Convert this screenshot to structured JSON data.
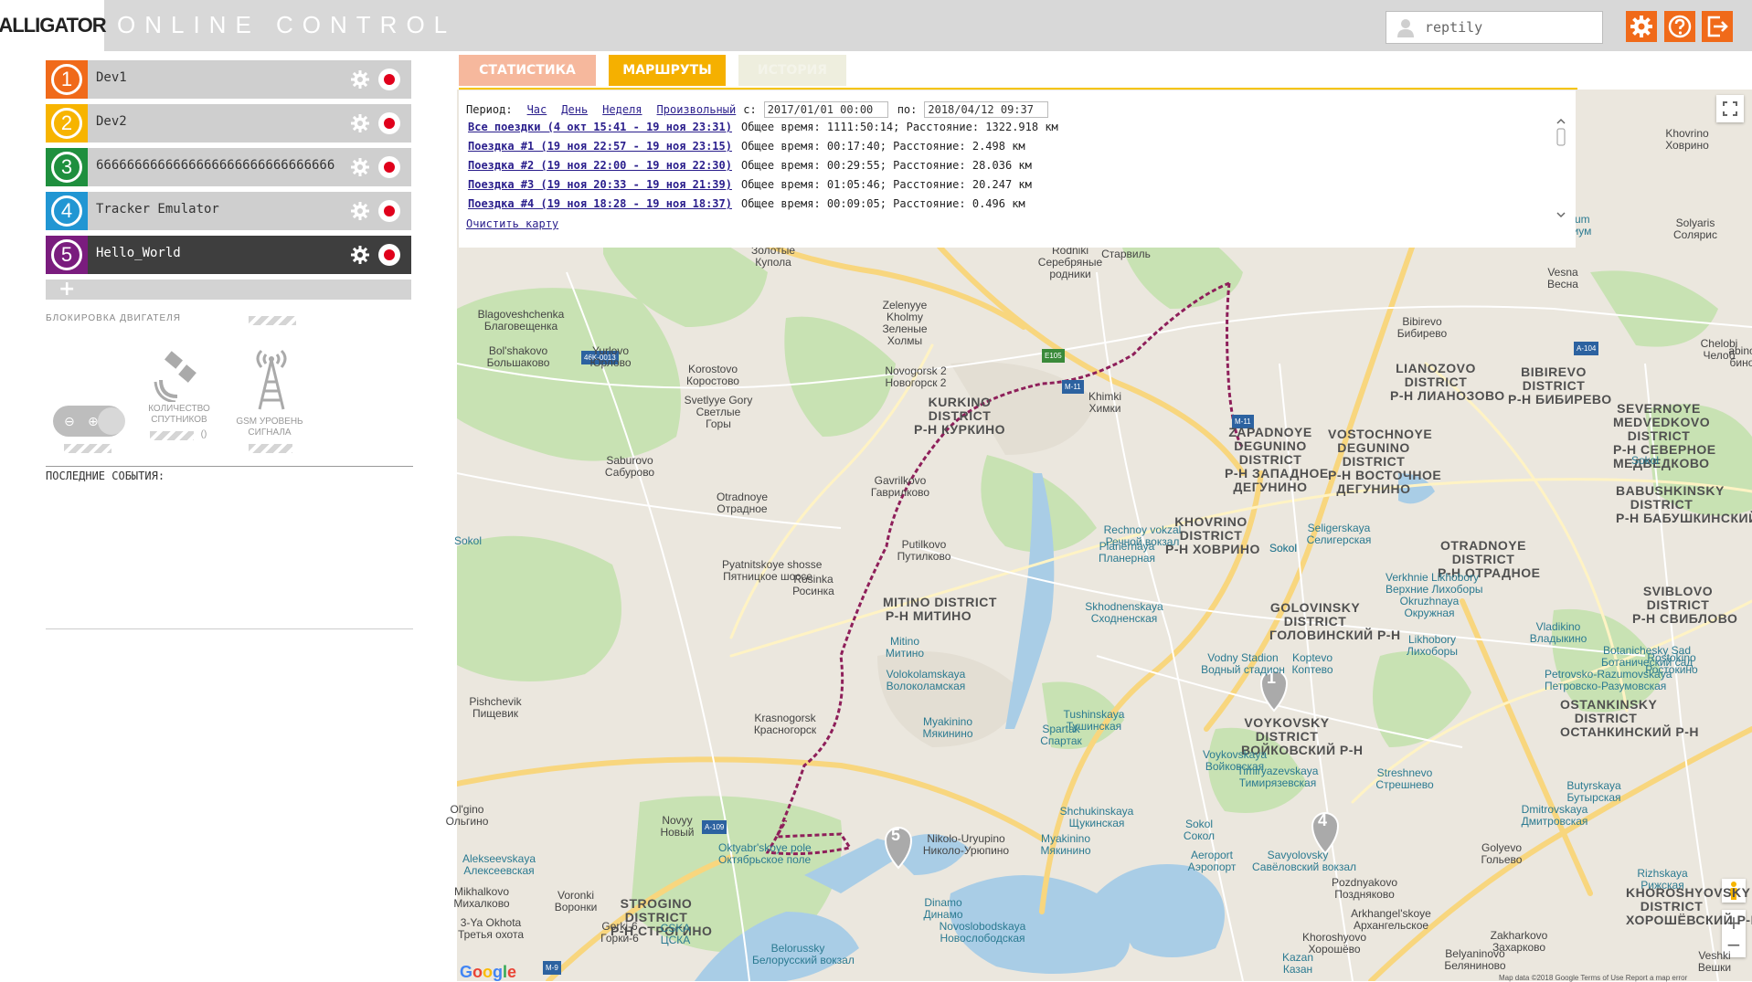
{
  "header": {
    "logo_text": "ALLIGATOR",
    "title": "ONLINE CONTROL",
    "user": "reptily",
    "colors": {
      "accent": "#f06a1a",
      "header_bg": "#d8d8d8"
    },
    "icons": [
      "gear-icon",
      "help-icon",
      "logout-icon"
    ]
  },
  "devices": [
    {
      "num": "1",
      "name": "Dev1",
      "color": "#f06a1a"
    },
    {
      "num": "2",
      "name": "Dev2",
      "color": "#f7b400"
    },
    {
      "num": "3",
      "name": "6666666666666666666666666666666",
      "color": "#1f8f3e"
    },
    {
      "num": "4",
      "name": "Tracker Emulator",
      "color": "#2196d3"
    },
    {
      "num": "5",
      "name": "Hello_World",
      "color": "#7a1c7e"
    }
  ],
  "sidebar": {
    "add_label": "+",
    "engine_lock": "БЛОКИРОВКА ДВИГАТЕЛЯ",
    "satellites": "КОЛИЧЕСТВО\nСПУТНИКОВ",
    "satellites_value": "()",
    "gsm": "GSM УРОВЕНЬ\nСИГНАЛА",
    "events_title": "ПОСЛЕДНИЕ СОБЫТИЯ:"
  },
  "tabs": [
    {
      "label": "СТАТИСТИКА",
      "color": "#f6b89d"
    },
    {
      "label": "МАРШРУТЫ",
      "color": "#f5b000"
    },
    {
      "label": "ИСТОРИЯ",
      "color": "#eeeede"
    }
  ],
  "routes": {
    "period_label": "Период:",
    "links": [
      "Час",
      "День",
      "Неделя",
      "Произвольный"
    ],
    "from_label": "с:",
    "from_value": "2017/01/01 00:00",
    "to_label": "по:",
    "to_value": "2018/04/12 09:37",
    "trips": [
      {
        "label": "Все поездки (4 окт 15:41 - 19 ноя 23:31)",
        "info": "Общее время: 1111:50:14; Расстояние: 1322.918 км"
      },
      {
        "label": "Поездка #1 (19 ноя 22:57 - 19 ноя 23:15)",
        "info": "Общее время: 00:17:40; Расстояние: 2.498 км"
      },
      {
        "label": "Поездка #2 (19 ноя 22:00 - 19 ноя 22:30)",
        "info": "Общее время: 00:29:55; Расстояние: 28.036 км"
      },
      {
        "label": "Поездка #3 (19 ноя 20:33 - 19 ноя 21:39)",
        "info": "Общее время: 01:05:46; Расстояние: 20.247 км"
      },
      {
        "label": "Поездка #4 (19 ноя 18:28 - 19 ноя 18:37)",
        "info": "Общее время: 00:09:05; Расстояние: 0.496 км"
      }
    ],
    "clear_map": "Очистить карту"
  },
  "map": {
    "markers": [
      "1",
      "4",
      "5"
    ],
    "footer": "Map data ©2018 Google   Terms of Use   Report a map error",
    "logo": "Google",
    "labels": [
      {
        "t": "Золотые\nКупола"
      },
      {
        "t": "Rodniki\nСеребряные\nродники"
      },
      {
        "t": "Старвиль"
      },
      {
        "t": "Blagoveshchenka\nБлаговещенка"
      },
      {
        "t": "Zelenyye\nKholmy\nЗеленые\nХолмы"
      },
      {
        "t": "Bol'shakovo\nБольшаково"
      },
      {
        "t": "Yurlovo\nЮрлово"
      },
      {
        "t": "Korostovo\nКоростово"
      },
      {
        "t": "Novogorsk 2\nНовогорск 2"
      },
      {
        "t": "Svetlyye Gory\nСветлые\nГоры"
      },
      {
        "t": "KURKINO\nDISTRICT\nР-Н КУРКИНО"
      },
      {
        "t": "Khimki\nХимки"
      },
      {
        "t": "LIANOZOVO\nDISTRICT\nР-Н ЛИАНОЗОВО"
      },
      {
        "t": "BIBIREVO\nDISTRICT\nР-Н БИБИРЕВО"
      },
      {
        "t": "SEVERNOYE\nMEDVEDKOVO\nDISTRICT\nР-Н СЕВЕРНОЕ\nМЕДВЕДКОВО"
      },
      {
        "t": "ZAPADNOYE\nDEGUNINO\nDISTRICT\nР-Н ЗАПАДНОЕ\nДЕГУНИНО"
      },
      {
        "t": "VOSTOCHNOYE\nDEGUNINO\nDISTRICT\nР-Н ВОСТОЧНОЕ\nДЕГУНИНО"
      },
      {
        "t": "Saburovo\nСабурово"
      },
      {
        "t": "Gavrilkovo\nГаврилково"
      },
      {
        "t": "Otradnoye\nОтрадное"
      },
      {
        "t": "KHOVRINO\nDISTRICT\nР-Н ХОВРИНО"
      },
      {
        "t": "Seligerskaya\nСелигерская"
      },
      {
        "t": "Putilkovo\nПутилково"
      },
      {
        "t": "Planernaya\nПланерная"
      },
      {
        "t": "Rechnoy vokzal\nРечной вокзал"
      },
      {
        "t": "BABUSHKINSKY\nDISTRICT\nР-Н БАБУШКИНСКИЙ"
      },
      {
        "t": "OTRADNOYE\nDISTRICT\nР-Н ОТРАДНОЕ"
      },
      {
        "t": "Verkhnie Likhobory\nВерхние Лихоборы"
      },
      {
        "t": "Pyatnitskoye shosse\nПятницкое шоссе"
      },
      {
        "t": "Rosinka\nРосинка"
      },
      {
        "t": "MITINO DISTRICT\nР-Н МИТИНО"
      },
      {
        "t": "Skhodnenskaya\nСходненская"
      },
      {
        "t": "GOLOVINSKY\nDISTRICT\nГОЛОВИНСКИЙ Р-Н"
      },
      {
        "t": "Okruzhnaya\nОкружная"
      },
      {
        "t": "SVIBLOVO\nDISTRICT\nР-Н СВИБЛОВО"
      },
      {
        "t": "Vladikino\nВладыкино"
      },
      {
        "t": "Mitino\nМитино"
      },
      {
        "t": "Likhobory\nЛихоборы"
      },
      {
        "t": "Botanichesky Sad\nБотанический сад"
      },
      {
        "t": "Volokolamskaya\nВолоколамская"
      },
      {
        "t": "Vodny Stadion\nВодный стадион"
      },
      {
        "t": "Koptevo\nКоптево"
      },
      {
        "t": "Petrovsko-Razumovskaya\nПетровско-Разумовская"
      },
      {
        "t": "Rostokino\nРостокино"
      },
      {
        "t": "Pishchevik\nПищевик"
      },
      {
        "t": "Krasnogorsk\nКрасногорск"
      },
      {
        "t": "Tushinskaya\nТушинская"
      },
      {
        "t": "VOYKOVSKY\nDISTRICT\nВОЙКОВСКИЙ Р-Н"
      },
      {
        "t": "OSTANKINSKY\nDISTRICT\nОСТАНКИНСКИЙ Р-Н"
      },
      {
        "t": "Myakinino\nМякинино"
      },
      {
        "t": "Spartak\nСпартак"
      },
      {
        "t": "Voykovskaya\nВойковская"
      },
      {
        "t": "Timiryazevskaya\nТимирязевская"
      },
      {
        "t": "Streshnevo\nСтрешнево"
      },
      {
        "t": "Butyrskaya\nБутырская"
      },
      {
        "t": "Ol'gino\nОльгино"
      },
      {
        "t": "Novyy\nНовый"
      },
      {
        "t": "Shchukinskaya\nЩукинская"
      },
      {
        "t": "Sokol\nСокол"
      },
      {
        "t": "Dmitrovskaya\nДмитровская"
      },
      {
        "t": "Alekseevskaya\nАлексеевская"
      },
      {
        "t": "Nikolo-Uryupino\nНиколо-Урюпино"
      },
      {
        "t": "Myakinino\nМякинино"
      },
      {
        "t": "Aeroport\nАэропорт"
      },
      {
        "t": "Golyevo\nГольево"
      },
      {
        "t": "Oktyabr'skoye pole\nОктябрьское поле"
      },
      {
        "t": "Savyolovsky\nСавёловский вокзал"
      },
      {
        "t": "Rizhskaya\nРижская"
      },
      {
        "t": "KHOROSHYOVSKY\nDISTRICT\nХОРОШЁВСКИЙ Р-Н"
      },
      {
        "t": "Pozdnyakovo\nПоздняково"
      },
      {
        "t": "Mikhalkovo\nМихалково"
      },
      {
        "t": "Voronki\nВоронки"
      },
      {
        "t": "STROGINO\nDISTRICT\nР-Н СТРОГИНО"
      },
      {
        "t": "Dinamo\nДинамо"
      },
      {
        "t": "Arkhangel'skoye\nАрхангельское"
      },
      {
        "t": "3-Ya Okhota\nТретья охота"
      },
      {
        "t": "Gorki-6\nГорки-6"
      },
      {
        "t": "Novoslobodskaya\nНовослободская"
      },
      {
        "t": "CSKA\nЦСКА"
      },
      {
        "t": "Zakharkovo\nЗахарково"
      },
      {
        "t": "Khoroshyovo\nХорошёво"
      },
      {
        "t": "Belorussky\nБелорусский вокзал"
      },
      {
        "t": "Kazan\nКазан"
      },
      {
        "t": "Belyaninovo\nБеляниново"
      },
      {
        "t": "Veshki\nВешки"
      },
      {
        "t": "Khovrino\nХоврино"
      },
      {
        "t": "Vesna\nВесна"
      },
      {
        "t": "Solyaris\nСолярис"
      },
      {
        "t": "Oceanarium\nОкеанариум"
      },
      {
        "t": "Chelobi\nЧелоб"
      },
      {
        "t": "Bibirevo\nБибирево"
      },
      {
        "t": "abino\nбино"
      },
      {
        "t": "Sokol"
      },
      {
        "t": "Sokol"
      },
      {
        "t": "Sokol"
      },
      {
        "t": "Sokol"
      }
    ],
    "roads": [
      "A-104",
      "M-11",
      "E105",
      "46K-0013",
      "M-11",
      "A-109",
      "M-9"
    ]
  }
}
